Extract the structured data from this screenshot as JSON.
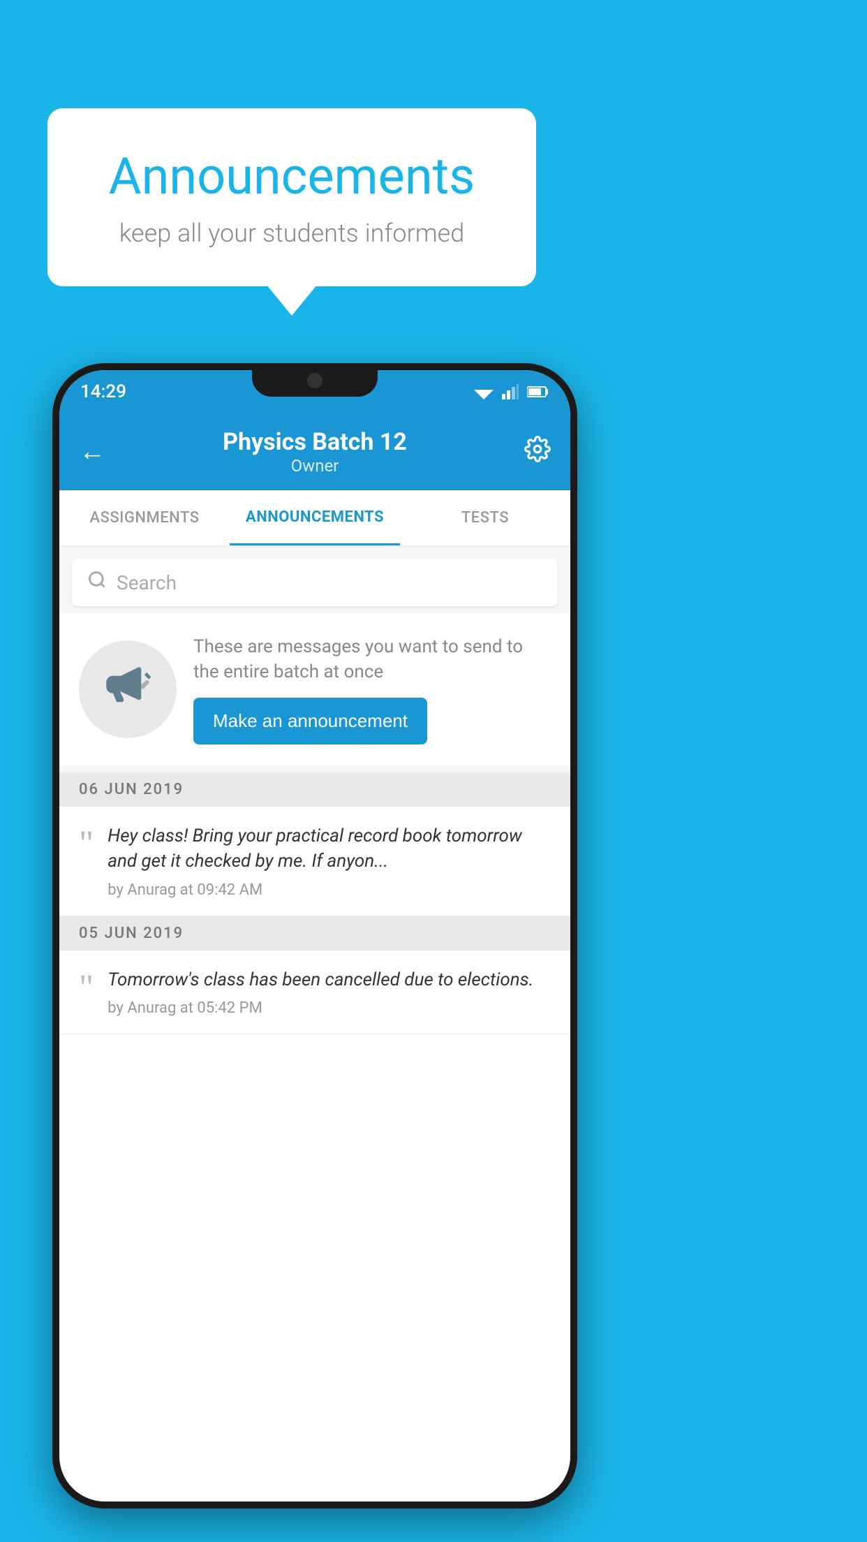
{
  "background_color": "#1ab5e8",
  "speech_bubble": {
    "title": "Announcements",
    "subtitle": "keep all your students informed"
  },
  "phone": {
    "status_bar": {
      "time": "14:29"
    },
    "header": {
      "back_label": "←",
      "title": "Physics Batch 12",
      "subtitle": "Owner",
      "settings_label": "⚙"
    },
    "tabs": [
      {
        "label": "ASSIGNMENTS",
        "active": false
      },
      {
        "label": "ANNOUNCEMENTS",
        "active": true
      },
      {
        "label": "TESTS",
        "active": false
      }
    ],
    "search": {
      "placeholder": "Search"
    },
    "announcement_prompt": {
      "description": "These are messages you want to send to the entire batch at once",
      "button_label": "Make an announcement"
    },
    "announcements": [
      {
        "date": "06  JUN  2019",
        "text": "Hey class! Bring your practical record book tomorrow and get it checked by me. If anyon...",
        "meta": "by Anurag at 09:42 AM"
      },
      {
        "date": "05  JUN  2019",
        "text": "Tomorrow's class has been cancelled due to elections.",
        "meta": "by Anurag at 05:42 PM"
      }
    ]
  }
}
